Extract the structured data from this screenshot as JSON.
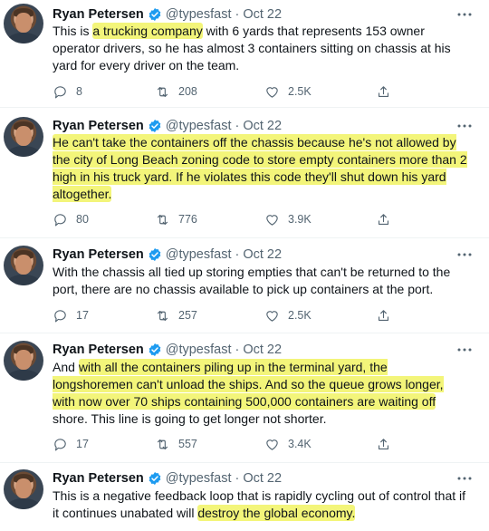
{
  "tweets": [
    {
      "author": "Ryan Petersen",
      "handle": "@typesfast",
      "date": "Oct 22",
      "text_html": "This is <mark>a trucking company</mark> with 6 yards that represents 153 owner operator drivers, so he has almost 3 containers sitting on chassis at his yard for every driver on the team.",
      "replies": "8",
      "retweets": "208",
      "likes": "2.5K"
    },
    {
      "author": "Ryan Petersen",
      "handle": "@typesfast",
      "date": "Oct 22",
      "text_html": "<mark>He can't take the containers off the chassis because he's not allowed by the city of Long Beach zoning code to store empty containers more than 2 high in his truck yard. If he violates this code they'll shut down his yard altogether.</mark>",
      "replies": "80",
      "retweets": "776",
      "likes": "3.9K"
    },
    {
      "author": "Ryan Petersen",
      "handle": "@typesfast",
      "date": "Oct 22",
      "text_html": "With the chassis all tied up storing empties that can't be returned to the port, there are no chassis available to pick up containers at the port.",
      "replies": "17",
      "retweets": "257",
      "likes": "2.5K"
    },
    {
      "author": "Ryan Petersen",
      "handle": "@typesfast",
      "date": "Oct 22",
      "text_html": "And <mark>with all the containers piling up in the terminal yard, the longshoremen can't unload the ships. And so the queue grows longer, with now over 70 ships containing 500,000 containers are waiting off</mark> shore. This line is going to get longer not shorter.",
      "replies": "17",
      "retweets": "557",
      "likes": "3.4K"
    },
    {
      "author": "Ryan Petersen",
      "handle": "@typesfast",
      "date": "Oct 22",
      "text_html": "This is a negative feedback loop that is rapidly cycling out of control that if it continues unabated will <mark>destroy the global economy.</mark>",
      "replies": "",
      "retweets": "",
      "likes": ""
    }
  ],
  "icons": {
    "reply": "reply-icon",
    "retweet": "retweet-icon",
    "like": "heart-icon",
    "share": "share-icon",
    "verified": "verified-badge-icon",
    "more": "more-options-icon"
  },
  "colors": {
    "highlight": "#f3f57a",
    "verified": "#1d9bf0",
    "secondary_text": "#536471"
  }
}
